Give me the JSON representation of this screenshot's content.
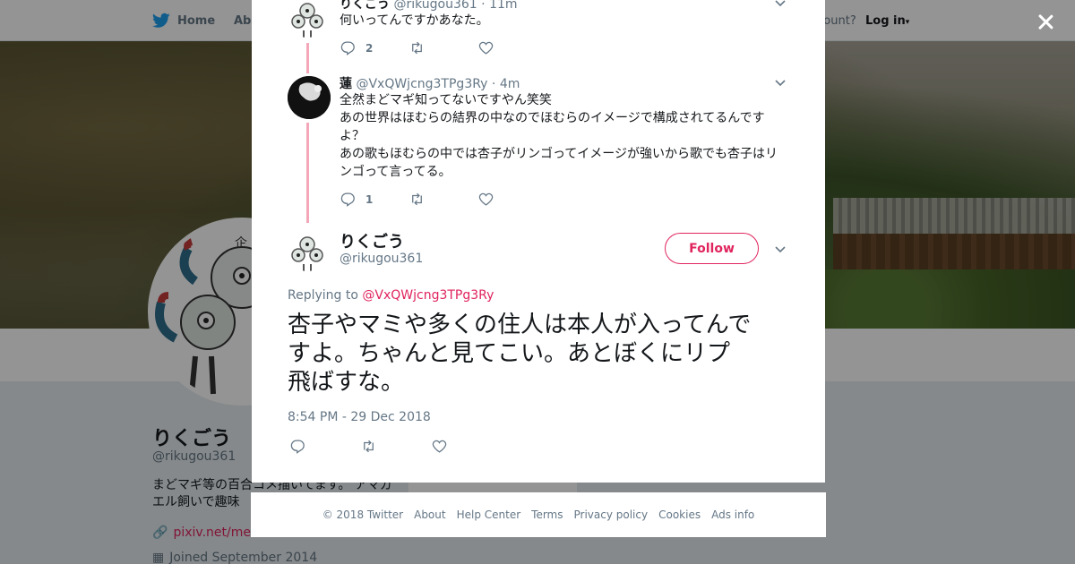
{
  "topnav": {
    "home_label": "Home",
    "about_label": "Abo",
    "account_prompt": "ccount?",
    "login_label": "Log in"
  },
  "background_profile": {
    "name": "りくごう",
    "handle": "@rikugou361",
    "bio": "まどマギ等の百合コメ描いてます。 アマガエル飼いで趣味",
    "link": "pixiv.net/mem",
    "joined": "Joined September 2014",
    "card_text": "Ads info"
  },
  "conversation": [
    {
      "name": "りくごう",
      "handle": "@rikugou361",
      "time": "11m",
      "text": "何いってんですかあなた。",
      "reply_count": "2"
    },
    {
      "name": "蓮",
      "handle": "@VxQWjcng3TPg3Ry",
      "time": "4m",
      "lines": [
        "全然まどマギ知ってないですやん笑笑",
        "あの世界はほむらの結界の中なのでほむらのイメージで構成されてるんです",
        "よ？",
        "あの歌もほむらの中では杏子がリンゴってイメージが強いから歌でも杏子はリ",
        "ンゴって言ってる。"
      ],
      "reply_count": "1"
    }
  ],
  "main_tweet": {
    "name": "りくごう",
    "handle": "@rikugou361",
    "follow_label": "Follow",
    "replying_prefix": "Replying to",
    "replying_to": "@VxQWjcng3TPg3Ry",
    "lines": [
      "杏子やマミや多くの住人は本人が入ってんで",
      "すよ。ちゃんと見てこい。あとぼくにリプ",
      "飛ばすな。"
    ],
    "timestamp": "8:54 PM - 29 Dec 2018"
  },
  "footer": {
    "copyright": "© 2018 Twitter",
    "links": [
      "About",
      "Help Center",
      "Terms",
      "Privacy policy",
      "Cookies",
      "Ads info"
    ]
  },
  "colors": {
    "accent": "#e0245e",
    "thread_line": "#f4a7b8",
    "muted_text": "#657786",
    "twitter_blue": "#1da1f2"
  },
  "icons": [
    "twitter-bird-icon",
    "reply-icon",
    "retweet-icon",
    "like-icon",
    "chevron-down-icon",
    "close-icon",
    "link-icon",
    "calendar-icon"
  ]
}
